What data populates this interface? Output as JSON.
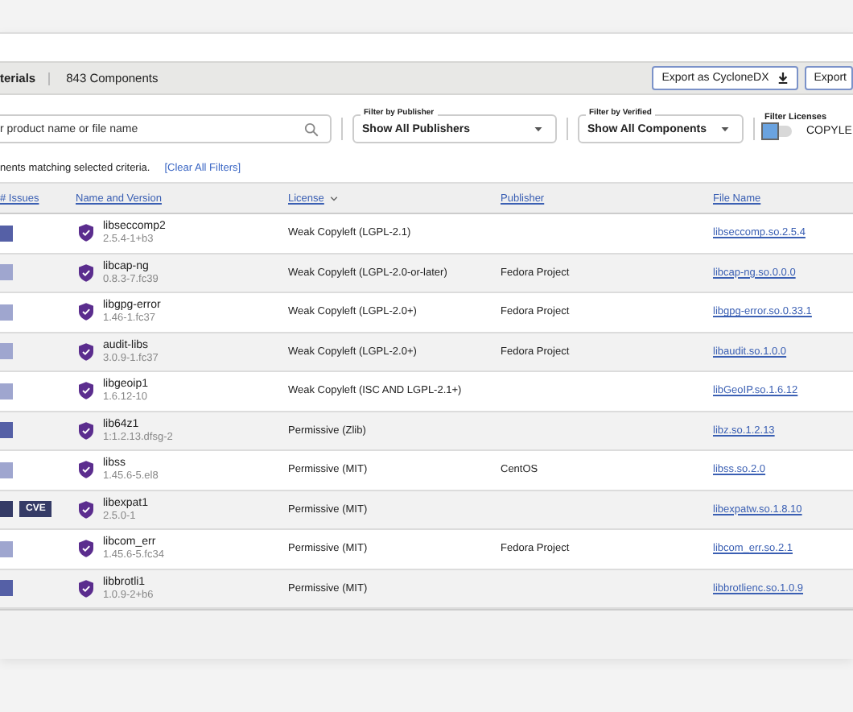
{
  "header": {
    "title": "terials",
    "count": "843 Components",
    "buttons": [
      {
        "label": "Export as CycloneDX"
      },
      {
        "label": "Export"
      }
    ]
  },
  "search": {
    "placeholder": "r product name or file name"
  },
  "filters": [
    {
      "label": "Filter by Publisher",
      "value": "Show All Publishers"
    },
    {
      "label": "Filter by Verified",
      "value": "Show All Components"
    }
  ],
  "license_filter": {
    "label": "Filter Licenses",
    "on": false,
    "option": "COPYLE"
  },
  "summary": {
    "text": "nents matching selected criteria.",
    "link": "[Clear All Filters]"
  },
  "table": {
    "columns": [
      {
        "label": "# Issues",
        "sorted": false
      },
      {
        "label": "Name and Version",
        "sorted": false
      },
      {
        "label": "License",
        "sorted": true
      },
      {
        "label": "Publisher",
        "sorted": false
      },
      {
        "label": "File Name",
        "sorted": false
      }
    ],
    "rows": [
      {
        "color": "#5560a6",
        "cve": "",
        "name": "libseccomp2",
        "version": "2.5.4-1+b3",
        "license": "Weak Copyleft (LGPL-2.1)",
        "publisher": "",
        "file": "libseccomp.so.2.5.4"
      },
      {
        "color": "#9fa6cf",
        "cve": "",
        "name": "libcap-ng",
        "version": "0.8.3-7.fc39",
        "license": "Weak Copyleft (LGPL-2.0-or-later)",
        "publisher": "Fedora Project",
        "file": "libcap-ng.so.0.0.0"
      },
      {
        "color": "#9fa6cf",
        "cve": "",
        "name": "libgpg-error",
        "version": "1.46-1.fc37",
        "license": "Weak Copyleft (LGPL-2.0+)",
        "publisher": "Fedora Project",
        "file": "libgpg-error.so.0.33.1"
      },
      {
        "color": "#9fa6cf",
        "cve": "",
        "name": "audit-libs",
        "version": "3.0.9-1.fc37",
        "license": "Weak Copyleft (LGPL-2.0+)",
        "publisher": "Fedora Project",
        "file": "libaudit.so.1.0.0"
      },
      {
        "color": "#9fa6cf",
        "cve": "",
        "name": "libgeoip1",
        "version": "1.6.12-10",
        "license": "Weak Copyleft (ISC AND LGPL-2.1+)",
        "publisher": "",
        "file": "libGeoIP.so.1.6.12"
      },
      {
        "color": "#5560a6",
        "cve": "",
        "name": "lib64z1",
        "version": "1:1.2.13.dfsg-2",
        "license": "Permissive (Zlib)",
        "publisher": "",
        "file": "libz.so.1.2.13"
      },
      {
        "color": "#9fa6cf",
        "cve": "",
        "name": "libss",
        "version": "1.45.6-5.el8",
        "license": "Permissive (MIT)",
        "publisher": "CentOS",
        "file": "libss.so.2.0"
      },
      {
        "color": "#353b66",
        "cve": "CVE",
        "name": "libexpat1",
        "version": "2.5.0-1",
        "license": "Permissive (MIT)",
        "publisher": "",
        "file": "libexpatw.so.1.8.10"
      },
      {
        "color": "#9fa6cf",
        "cve": "",
        "name": "libcom_err",
        "version": "1.45.6-5.fc34",
        "license": "Permissive (MIT)",
        "publisher": "Fedora Project",
        "file": "libcom_err.so.2.1"
      },
      {
        "color": "#5560a6",
        "cve": "",
        "name": "libbrotli1",
        "version": "1.0.9-2+b6",
        "license": "Permissive (MIT)",
        "publisher": "",
        "file": "libbrotlienc.so.1.0.9"
      }
    ]
  }
}
